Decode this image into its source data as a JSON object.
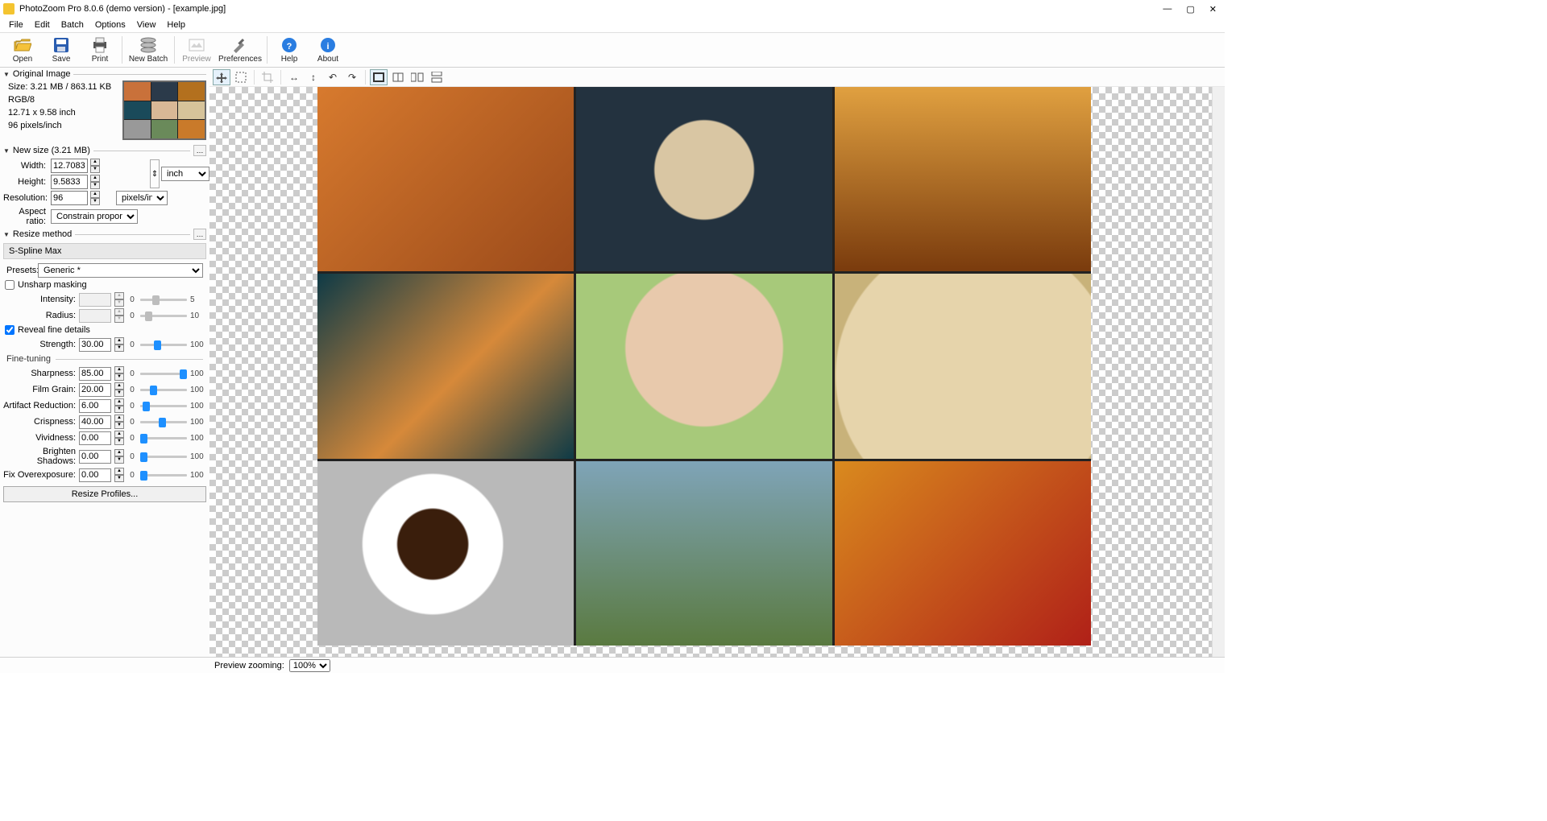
{
  "window": {
    "title": "PhotoZoom Pro 8.0.6 (demo version) - [example.jpg]"
  },
  "menus": [
    "File",
    "Edit",
    "Batch",
    "Options",
    "View",
    "Help"
  ],
  "toolbar": [
    {
      "id": "open",
      "label": "Open"
    },
    {
      "id": "save",
      "label": "Save"
    },
    {
      "id": "print",
      "label": "Print"
    },
    {
      "sep": true
    },
    {
      "id": "newbatch",
      "label": "New Batch"
    },
    {
      "sep": true
    },
    {
      "id": "preview",
      "label": "Preview",
      "disabled": true
    },
    {
      "id": "prefs",
      "label": "Preferences"
    },
    {
      "sep": true
    },
    {
      "id": "help",
      "label": "Help"
    },
    {
      "id": "about",
      "label": "About"
    }
  ],
  "original": {
    "header": "Original Image",
    "size_line": "Size: 3.21 MB / 863.11 KB",
    "mode": "RGB/8",
    "dims": "12.71 x 9.58 inch",
    "ppi": "96 pixels/inch"
  },
  "newsize": {
    "header": "New size (3.21 MB)",
    "labels": {
      "width": "Width:",
      "height": "Height:",
      "resolution": "Resolution:",
      "aspect": "Aspect ratio:",
      "unit_dim": "inch",
      "unit_res": "pixels/inch"
    },
    "width": "12.7083",
    "height": "9.5833",
    "resolution": "96",
    "aspect_mode": "Constrain proportions"
  },
  "resize": {
    "header": "Resize method",
    "algorithm": "S-Spline Max",
    "presets_label": "Presets:",
    "preset": "Generic *",
    "unsharp": {
      "label": "Unsharp masking",
      "checked": false,
      "intensity_label": "Intensity:",
      "intensity": "",
      "radius_label": "Radius:",
      "radius": "",
      "intensity_max": "5",
      "radius_max": "10"
    },
    "reveal": {
      "label": "Reveal fine details",
      "checked": true,
      "strength_label": "Strength:",
      "strength": "30.00",
      "min": "0",
      "max": "100"
    },
    "finetune": {
      "header": "Fine-tuning",
      "rows": [
        {
          "label": "Sharpness:",
          "value": "85.00"
        },
        {
          "label": "Film Grain:",
          "value": "20.00"
        },
        {
          "label": "Artifact Reduction:",
          "value": "6.00"
        },
        {
          "label": "Crispness:",
          "value": "40.00"
        },
        {
          "label": "Vividness:",
          "value": "0.00"
        },
        {
          "label": "Brighten Shadows:",
          "value": "0.00"
        },
        {
          "label": "Fix Overexposure:",
          "value": "0.00"
        }
      ],
      "min": "0",
      "max": "100"
    },
    "profiles_btn": "Resize Profiles..."
  },
  "status": {
    "zoom_label": "Preview zooming:",
    "zoom_value": "100%"
  }
}
